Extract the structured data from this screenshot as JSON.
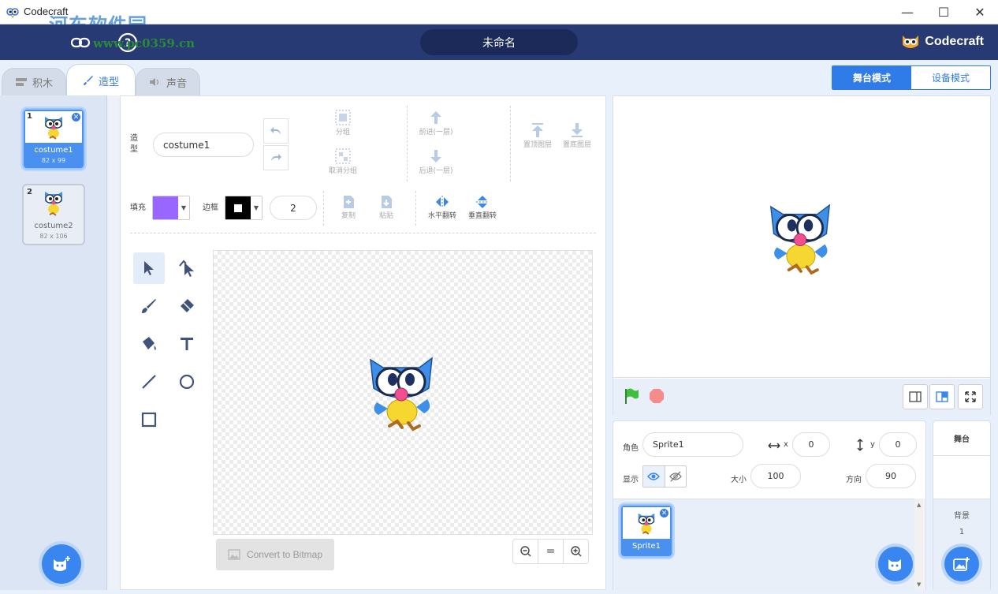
{
  "window": {
    "title": "Codecraft",
    "watermark": "河东软件园",
    "watermark_url": "www.pc0359.cn"
  },
  "header": {
    "project_name": "未命名",
    "brand": "Codecraft"
  },
  "tabs": [
    {
      "label": "积木",
      "icon": "blocks-icon"
    },
    {
      "label": "造型",
      "icon": "brush-icon",
      "active": true
    },
    {
      "label": "声音",
      "icon": "speaker-icon"
    }
  ],
  "mode_toggle": {
    "stage_mode": "舞台模式",
    "device_mode": "设备模式"
  },
  "costumes": [
    {
      "index": "1",
      "name": "costume1",
      "size": "82 x 99",
      "selected": true
    },
    {
      "index": "2",
      "name": "costume2",
      "size": "82 x 106"
    }
  ],
  "editor": {
    "costume_label": "造型",
    "costume_name": "costume1",
    "group": "分组",
    "ungroup": "取消分组",
    "forward": "前进(一层)",
    "backward": "后退(一层)",
    "front": "置顶图层",
    "back": "置底图层",
    "fill_label": "填充",
    "fill_color": "#9966ff",
    "outline_label": "边框",
    "outline_color": "#000000",
    "stroke_width": "2",
    "copy": "复制",
    "paste": "粘贴",
    "flip_h": "水平翻转",
    "flip_v": "垂直翻转",
    "convert": "Convert to Bitmap",
    "zoom_reset": "="
  },
  "sprite_info": {
    "role_label": "角色",
    "sprite_name": "Sprite1",
    "x_label": "x",
    "x": "0",
    "y_label": "y",
    "y": "0",
    "show_label": "显示",
    "size_label": "大小",
    "size": "100",
    "direction_label": "方向",
    "direction": "90"
  },
  "sprites": [
    {
      "name": "Sprite1"
    }
  ],
  "stage_side": {
    "title": "舞台",
    "backdrop_label": "背景",
    "backdrop_count": "1"
  }
}
